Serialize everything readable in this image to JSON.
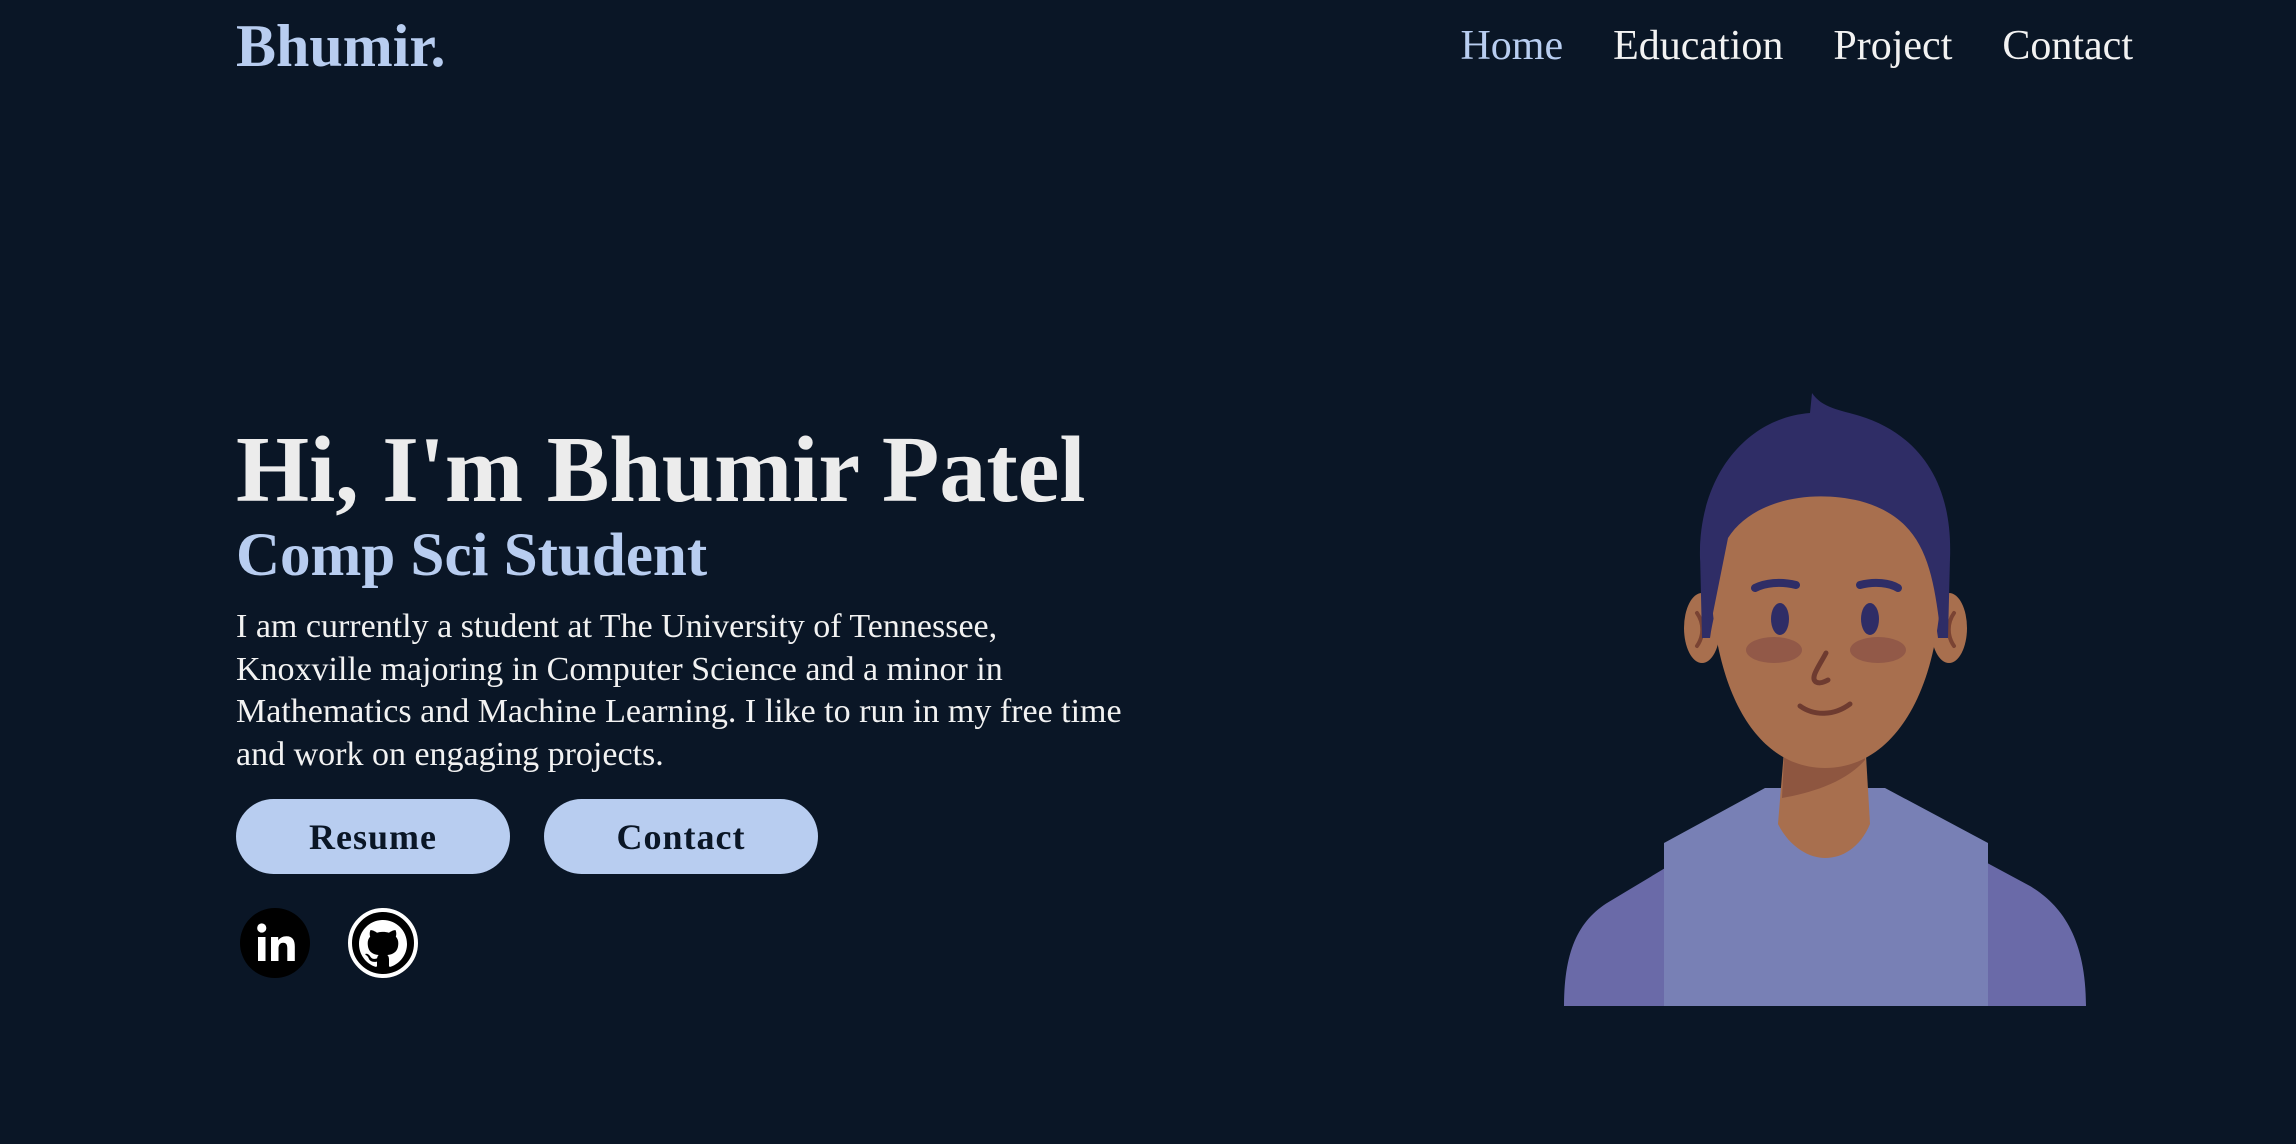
{
  "header": {
    "logo": "Bhumir.",
    "nav": [
      {
        "label": "Home",
        "active": true
      },
      {
        "label": "Education",
        "active": false
      },
      {
        "label": "Project",
        "active": false
      },
      {
        "label": "Contact",
        "active": false
      }
    ]
  },
  "hero": {
    "title": "Hi, I'm Bhumir Patel",
    "subtitle": "Comp Sci Student",
    "description": "I am currently a student at The University of Tennessee, Knoxville majoring in Computer Science and a minor in Mathematics and Machine Learning. I like to run in my free time and work on engaging projects.",
    "buttons": {
      "resume": "Resume",
      "contact": "Contact"
    }
  },
  "socials": {
    "icons": [
      "linkedin-icon",
      "github-icon"
    ]
  },
  "avatar": {
    "icon": "avatar-illustration"
  },
  "colors": {
    "background": "#0a1626",
    "accent": "#b8cdf0",
    "text": "#f2f2f2",
    "skin": "#a86f4e",
    "hair": "#2f2d66",
    "shirt": "#7880b5"
  }
}
